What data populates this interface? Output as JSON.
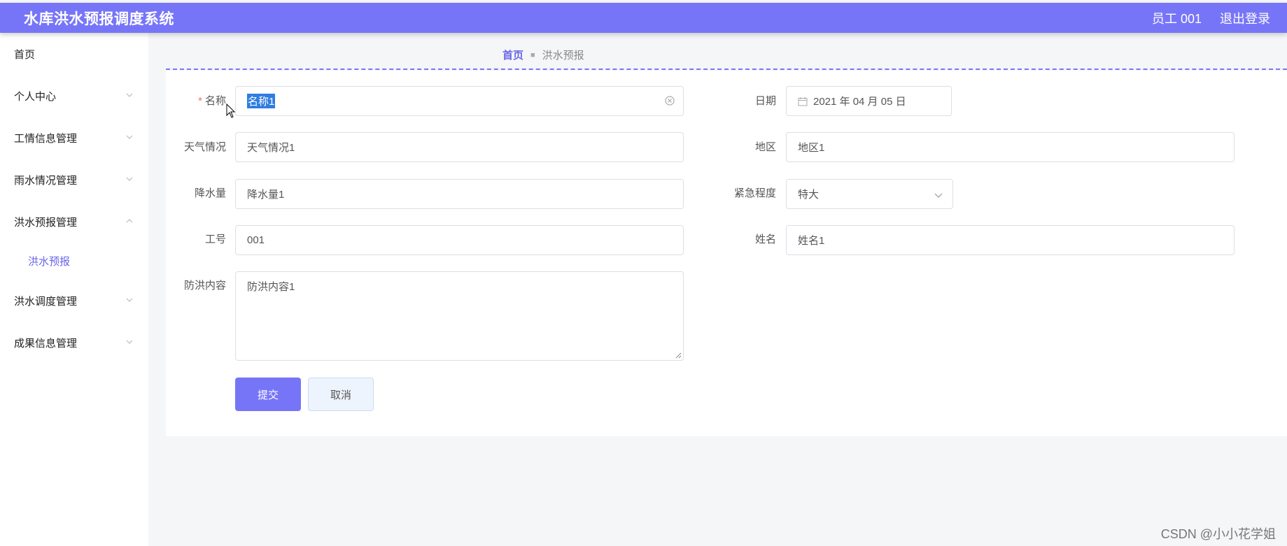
{
  "header": {
    "app_title": "水库洪水预报调度系统",
    "user_label": "员工 001",
    "logout_label": "退出登录"
  },
  "sidebar": {
    "items": [
      {
        "label": "首页"
      },
      {
        "label": "个人中心"
      },
      {
        "label": "工情信息管理"
      },
      {
        "label": "雨水情况管理"
      },
      {
        "label": "洪水预报管理"
      },
      {
        "label": "洪水预报"
      },
      {
        "label": "洪水调度管理"
      },
      {
        "label": "成果信息管理"
      }
    ]
  },
  "breadcrumb": {
    "home": "首页",
    "current": "洪水预报"
  },
  "form": {
    "name": {
      "label": "名称",
      "value": "名称1"
    },
    "date": {
      "label": "日期",
      "value": "2021 年 04 月 05 日"
    },
    "weather": {
      "label": "天气情况",
      "value": "天气情况1"
    },
    "region": {
      "label": "地区",
      "value": "地区1"
    },
    "rainfall": {
      "label": "降水量",
      "value": "降水量1"
    },
    "urgency": {
      "label": "紧急程度",
      "value": "特大"
    },
    "employee_id": {
      "label": "工号",
      "value": "001"
    },
    "person_name": {
      "label": "姓名",
      "value": "姓名1"
    },
    "content": {
      "label": "防洪内容",
      "value": "防洪内容1"
    },
    "submit_label": "提交",
    "cancel_label": "取消"
  },
  "watermark": "CSDN @小小花学姐",
  "colors": {
    "accent": "#7775f7",
    "required": "#f56c6c",
    "selection": "#2f7de1"
  }
}
